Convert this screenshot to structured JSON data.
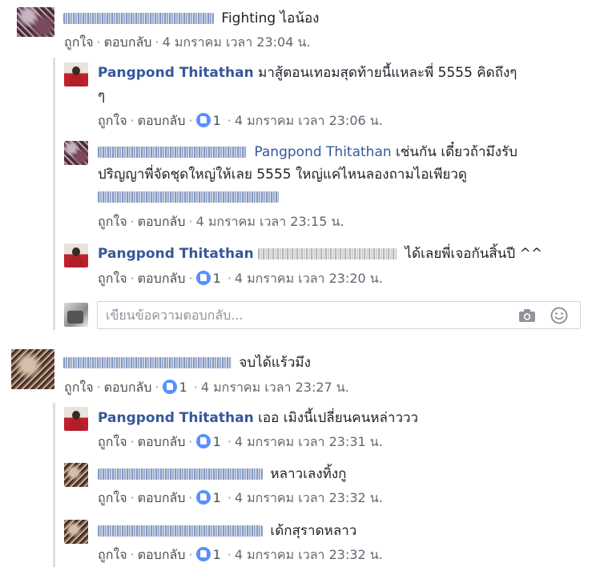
{
  "actions": {
    "like": "ถูกใจ",
    "reply": "ตอบกลับ",
    "sep": "·"
  },
  "comments": [
    {
      "author": "",
      "text": "Fighting ไอน้อง",
      "time": "4 มกราคม เวลา 23:04 น.",
      "likes": ""
    },
    {
      "author": "Pangpond Thitathan",
      "text_line1": "มาสู้ตอนเทอมสุดท้ายนี้แหละพี่ 5555 คิดถึงๆ",
      "text_line2": "ๆ",
      "time": "4 มกราคม เวลา 23:06 น.",
      "likes": "1"
    },
    {
      "author": "",
      "mention": "Pangpond Thitathan",
      "text_line1": "เช่นกัน เดี๋ยวถ้ามึงรับ",
      "text_line2": "ปริญญาพี่จัดชุดใหญ่ให้เลย 5555 ใหญ่แค่ไหนลองถามไอเพียวดู",
      "time": "4 มกราคม เวลา 23:15 น.",
      "likes": ""
    },
    {
      "author": "Pangpond Thitathan",
      "text": "ได้เลยพี่เจอกันสิ้นปี ^^",
      "time": "4 มกราคม เวลา 23:20 น.",
      "likes": "1"
    },
    {
      "author": "",
      "text": "จบได้แร้วมึง",
      "time": "4 มกราคม เวลา 23:27 น.",
      "likes": "1"
    },
    {
      "author": "Pangpond Thitathan",
      "text": "เออ เมิงนี้เปลี่ยนคนหล่าววว",
      "time": "4 มกราคม เวลา 23:31 น.",
      "likes": "1"
    },
    {
      "author": "",
      "text": "หลาวเลงทิ้งกู",
      "time": "4 มกราคม เวลา 23:32 น.",
      "likes": "1"
    },
    {
      "author": "",
      "text": "เด้กสุราดหลาว",
      "time": "4 มกราคม เวลา 23:32 น.",
      "likes": "1"
    }
  ],
  "reply_box": {
    "placeholder": "เขียนข้อความตอบกลับ...",
    "camera_icon": "camera-icon",
    "emoji_icon": "smile-icon"
  },
  "colors": {
    "name": "#365899",
    "meta": "#616770",
    "like": "#5890ff",
    "rail": "#dddfe2"
  }
}
